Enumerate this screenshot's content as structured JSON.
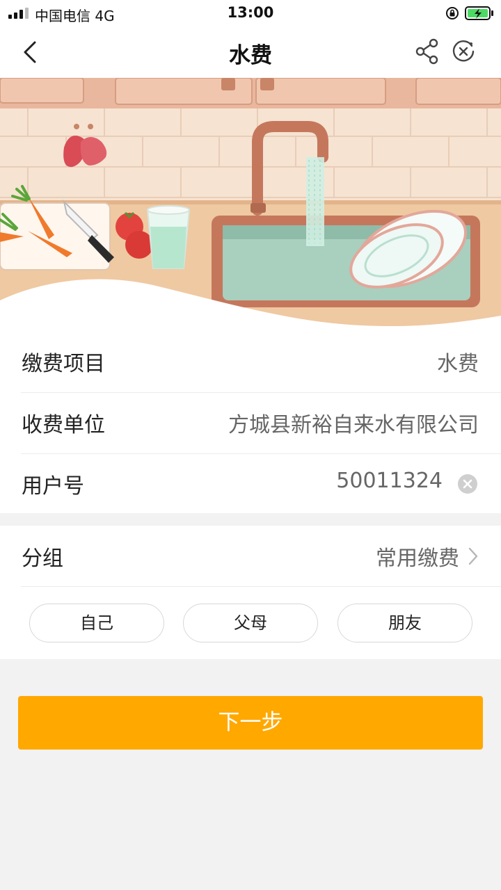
{
  "status": {
    "carrier": "中国电信  4G",
    "time": "13:00"
  },
  "nav": {
    "title": "水费",
    "back_icon": "chevron-left-icon",
    "share_icon": "share-icon",
    "close_icon": "close-circle-icon"
  },
  "banner": {
    "alt": "kitchen sink illustration"
  },
  "form": {
    "rows": [
      {
        "label": "缴费项目",
        "value": "水费"
      },
      {
        "label": "收费单位",
        "value": "方城县新裕自来水有限公司"
      },
      {
        "label": "用户号",
        "value": "50011324"
      }
    ]
  },
  "group": {
    "label": "分组",
    "value": "常用缴费",
    "chips": [
      "自己",
      "父母",
      "朋友"
    ]
  },
  "actions": {
    "next_label": "下一步"
  },
  "colors": {
    "accent": "#ffa800"
  }
}
